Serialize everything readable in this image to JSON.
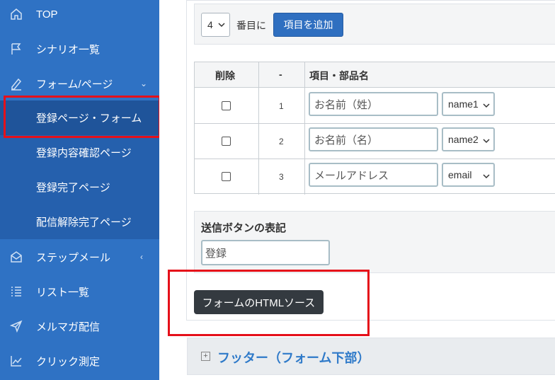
{
  "sidebar": {
    "items": [
      {
        "label": "TOP",
        "icon": "home-icon"
      },
      {
        "label": "シナリオ一覧",
        "icon": "flag-icon"
      },
      {
        "label": "フォーム/ページ",
        "icon": "pencil-icon",
        "chevron": "⌄"
      },
      {
        "label": "ステップメール",
        "icon": "envelope-icon",
        "chevron": "‹"
      },
      {
        "label": "リスト一覧",
        "icon": "list-icon"
      },
      {
        "label": "メルマガ配信",
        "icon": "send-icon"
      },
      {
        "label": "クリック測定",
        "icon": "chart-icon"
      }
    ],
    "sub_items": [
      {
        "label": "登録ページ・フォーム",
        "active": true
      },
      {
        "label": "登録内容確認ページ"
      },
      {
        "label": "登録完了ページ"
      },
      {
        "label": "配信解除完了ページ"
      }
    ]
  },
  "add_items": {
    "count_value": "4",
    "after_label": "番目に",
    "add_button": "項目を追加"
  },
  "table": {
    "headers": [
      "削除",
      "-",
      "項目・部品名"
    ],
    "rows": [
      {
        "num": "1",
        "label": "お名前（姓）",
        "field": "name1"
      },
      {
        "num": "2",
        "label": "お名前（名）",
        "field": "name2"
      },
      {
        "num": "3",
        "label": "メールアドレス",
        "field": "email"
      }
    ]
  },
  "submit": {
    "title": "送信ボタンの表記",
    "value": "登録"
  },
  "html_source_button": "フォームのHTMLソース",
  "footer": {
    "toggle": "+",
    "title": "フッター（フォーム下部）"
  },
  "colors": {
    "sidebar": "#2f72c4",
    "sidebar_sub": "#2560ad",
    "highlight": "#e5101a",
    "primary_button": "#2f6fc0",
    "dark_button": "#343a40",
    "link": "#2f7ac9"
  }
}
